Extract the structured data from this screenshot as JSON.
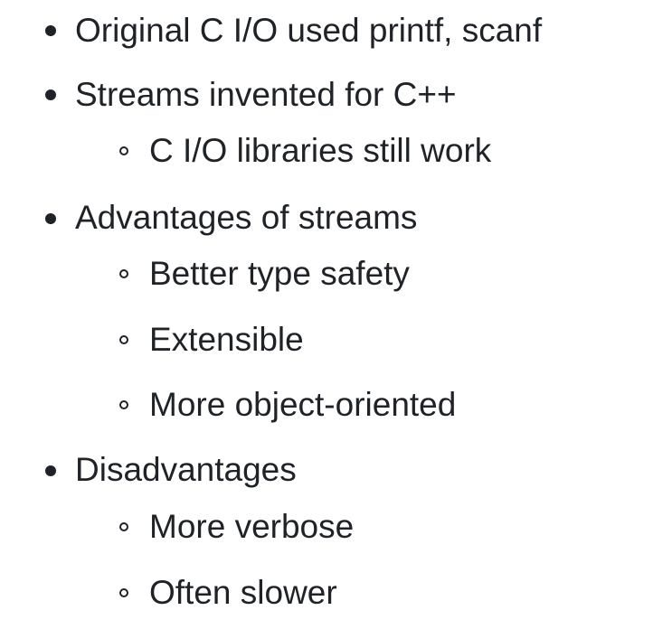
{
  "list": {
    "items": [
      {
        "label": "Original C I/O used printf, scanf",
        "children": []
      },
      {
        "label": "Streams invented for C++",
        "children": [
          "C I/O libraries still work"
        ]
      },
      {
        "label": "Advantages of streams",
        "children": [
          "Better type safety",
          "Extensible",
          "More object-oriented"
        ]
      },
      {
        "label": "Disadvantages",
        "children": [
          "More verbose",
          "Often slower"
        ]
      }
    ]
  }
}
